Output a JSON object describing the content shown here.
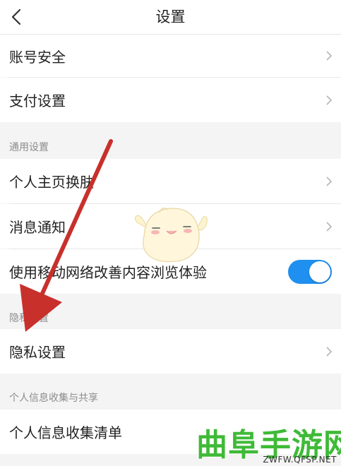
{
  "header": {
    "title": "设置"
  },
  "rows_top": [
    {
      "label": "账号安全"
    },
    {
      "label": "支付设置"
    }
  ],
  "section_general": {
    "title": "通用设置"
  },
  "rows_general": [
    {
      "label": "个人主页换肤"
    },
    {
      "label": "消息通知"
    },
    {
      "label": "使用移动网络改善内容浏览体验"
    }
  ],
  "toggle_mobile_network": {
    "on": true
  },
  "section_privacy": {
    "title": "隐私设置"
  },
  "rows_privacy": [
    {
      "label": "隐私设置"
    }
  ],
  "section_info": {
    "title": "个人信息收集与共享"
  },
  "rows_info": [
    {
      "label": "个人信息收集清单"
    }
  ],
  "watermark": {
    "text": "曲阜手游网",
    "url": "ZWFW.QFSP.NET"
  },
  "colors": {
    "accent": "#1f8ff0",
    "annotation_arrow": "#c8302c",
    "watermark_green": "#3fba37"
  },
  "icons": {
    "back": "chevron-left-icon",
    "row": "chevron-right-icon"
  }
}
